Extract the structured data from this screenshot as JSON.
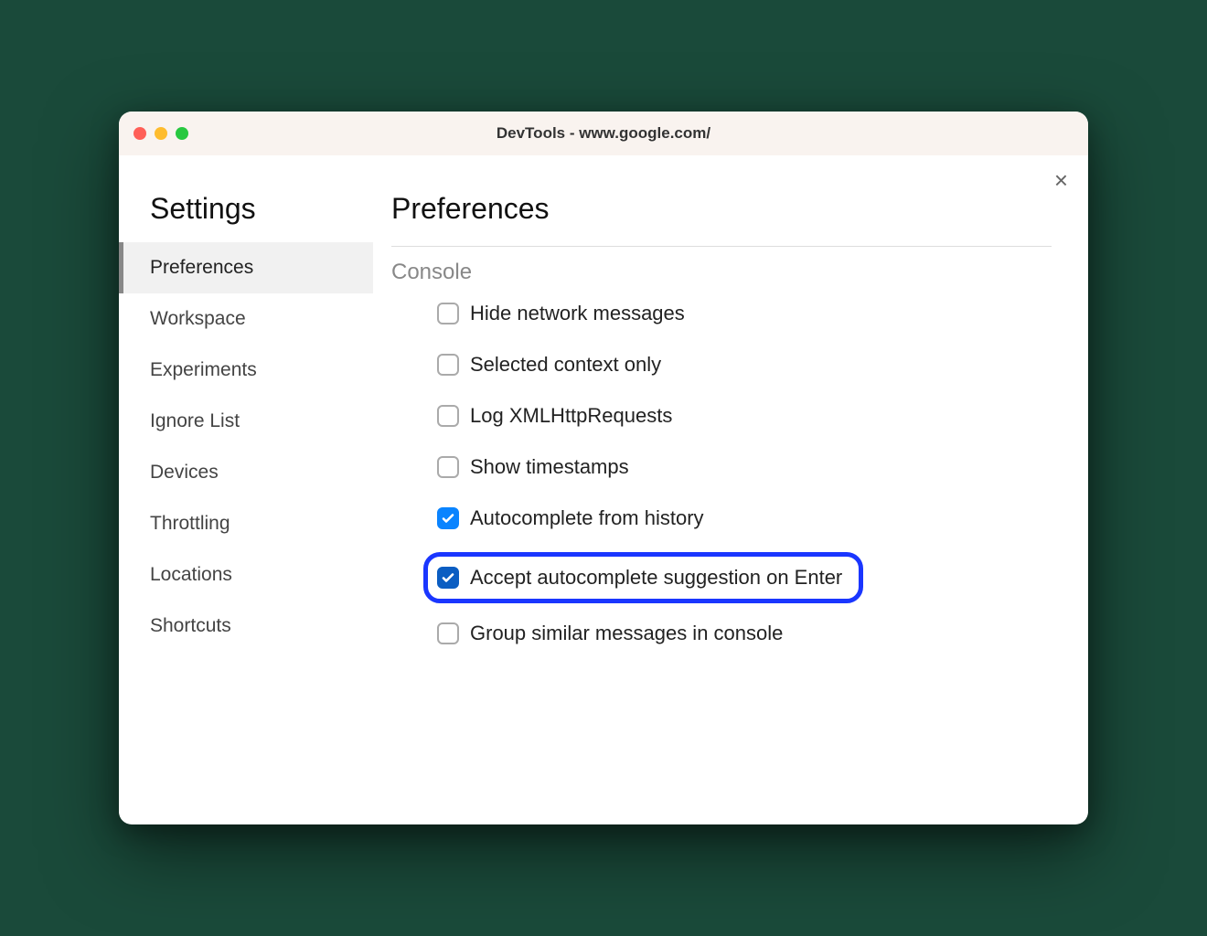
{
  "window": {
    "title": "DevTools - www.google.com/"
  },
  "sidebar": {
    "heading": "Settings",
    "items": [
      {
        "label": "Preferences",
        "active": true
      },
      {
        "label": "Workspace"
      },
      {
        "label": "Experiments"
      },
      {
        "label": "Ignore List"
      },
      {
        "label": "Devices"
      },
      {
        "label": "Throttling"
      },
      {
        "label": "Locations"
      },
      {
        "label": "Shortcuts"
      }
    ]
  },
  "main": {
    "heading": "Preferences",
    "section": "Console",
    "options": [
      {
        "label": "Hide network messages",
        "checked": false
      },
      {
        "label": "Selected context only",
        "checked": false
      },
      {
        "label": "Log XMLHttpRequests",
        "checked": false
      },
      {
        "label": "Show timestamps",
        "checked": false
      },
      {
        "label": "Autocomplete from history",
        "checked": true
      },
      {
        "label": "Accept autocomplete suggestion on Enter",
        "checked": true,
        "highlight": true
      },
      {
        "label": "Group similar messages in console",
        "checked": false
      }
    ]
  }
}
